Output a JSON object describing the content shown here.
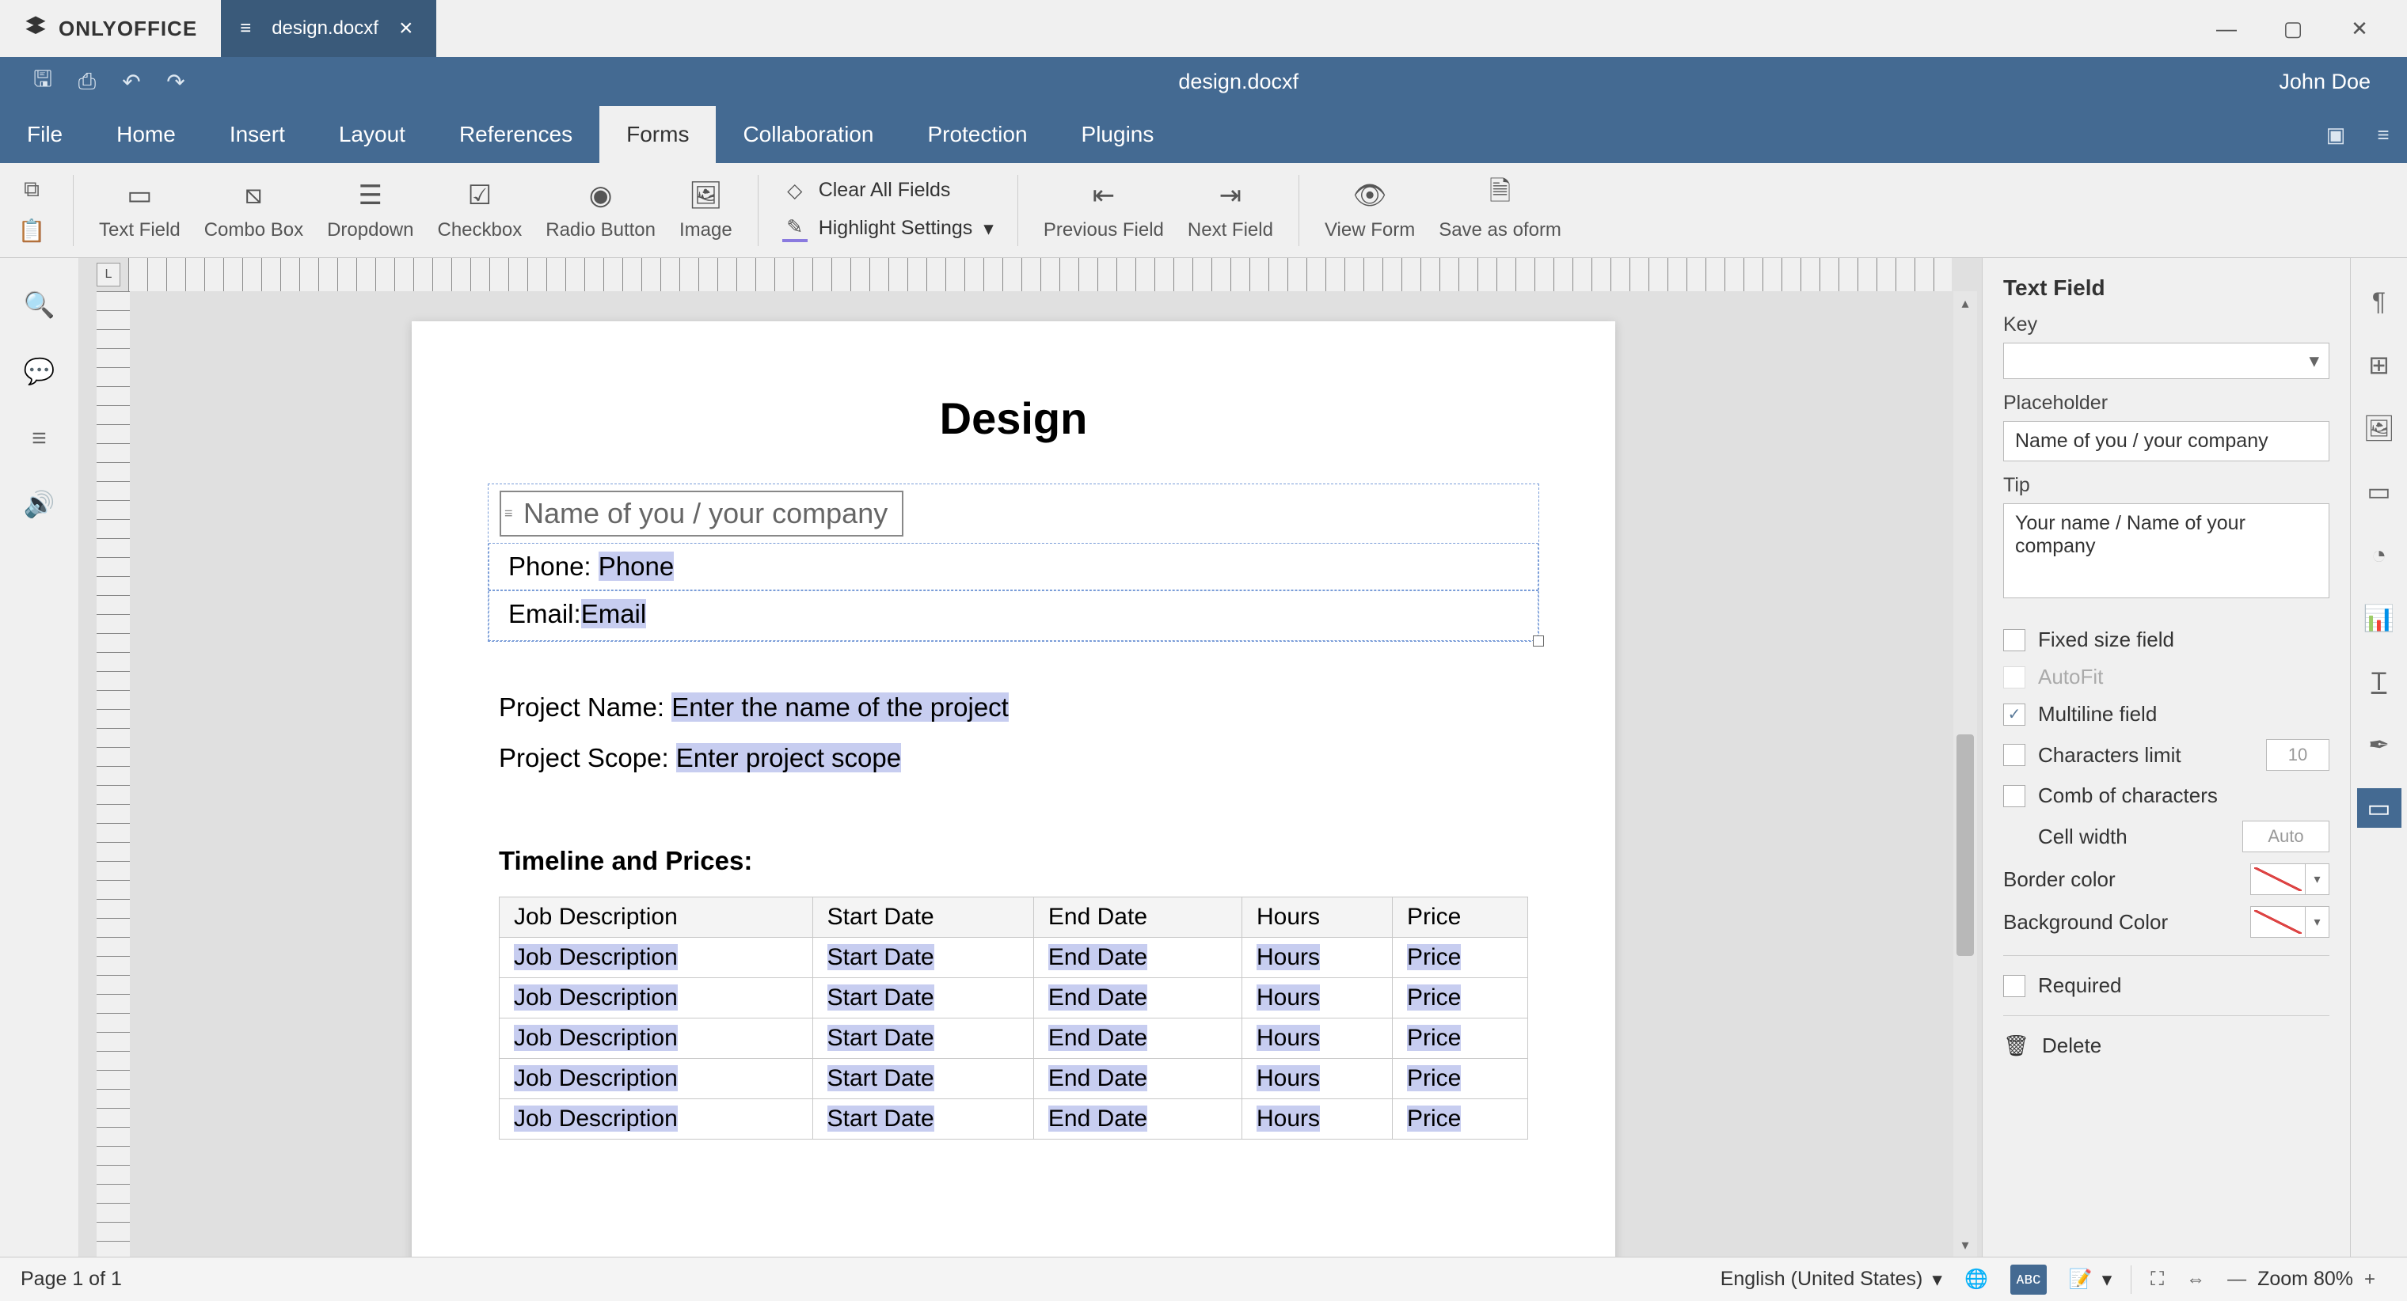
{
  "app": {
    "name": "ONLYOFFICE",
    "doc_tab": "design.docxf"
  },
  "header": {
    "title": "design.docxf",
    "user": "John Doe"
  },
  "menu": {
    "items": [
      "File",
      "Home",
      "Insert",
      "Layout",
      "References",
      "Forms",
      "Collaboration",
      "Protection",
      "Plugins"
    ],
    "active": "Forms"
  },
  "toolbar": {
    "text_field": "Text Field",
    "combo_box": "Combo Box",
    "dropdown": "Dropdown",
    "checkbox": "Checkbox",
    "radio_button": "Radio Button",
    "image": "Image",
    "clear_all": "Clear All Fields",
    "highlight": "Highlight Settings",
    "prev_field": "Previous Field",
    "next_field": "Next Field",
    "view_form": "View Form",
    "save_oform": "Save as oform"
  },
  "tooltip": "Your name / Name of your company",
  "doc": {
    "title": "Design",
    "company_placeholder": "Name of you / your company",
    "phone_label": "Phone: ",
    "phone_field": "Phone",
    "email_label": "Email:",
    "email_field": "Email",
    "project_name_label": "Project Name: ",
    "project_name_field": "Enter the name of the project",
    "project_scope_label": "Project Scope: ",
    "project_scope_field": "Enter project scope",
    "timeline_heading": "Timeline and Prices:",
    "table": {
      "headers": [
        "Job Description",
        "Start Date",
        "End Date",
        "Hours",
        "Price"
      ],
      "rows": [
        [
          "Job Description",
          "Start Date",
          "End Date",
          "Hours",
          "Price"
        ],
        [
          "Job Description",
          "Start Date",
          "End Date",
          "Hours",
          "Price"
        ],
        [
          "Job Description",
          "Start Date",
          "End Date",
          "Hours",
          "Price"
        ],
        [
          "Job Description",
          "Start Date",
          "End Date",
          "Hours",
          "Price"
        ],
        [
          "Job Description",
          "Start Date",
          "End Date",
          "Hours",
          "Price"
        ]
      ]
    }
  },
  "panel": {
    "title": "Text Field",
    "key_label": "Key",
    "placeholder_label": "Placeholder",
    "placeholder_value": "Name of you / your company",
    "tip_label": "Tip",
    "tip_value": "Your name / Name of your company",
    "fixed": "Fixed size field",
    "autofit": "AutoFit",
    "multiline": "Multiline field",
    "char_limit": "Characters limit",
    "char_limit_val": "10",
    "comb": "Comb of characters",
    "cell_width": "Cell width",
    "cell_width_val": "Auto",
    "border_color": "Border color",
    "bg_color": "Background Color",
    "required": "Required",
    "delete": "Delete"
  },
  "status": {
    "page": "Page 1 of 1",
    "lang": "English (United States)",
    "zoom": "Zoom 80%"
  }
}
